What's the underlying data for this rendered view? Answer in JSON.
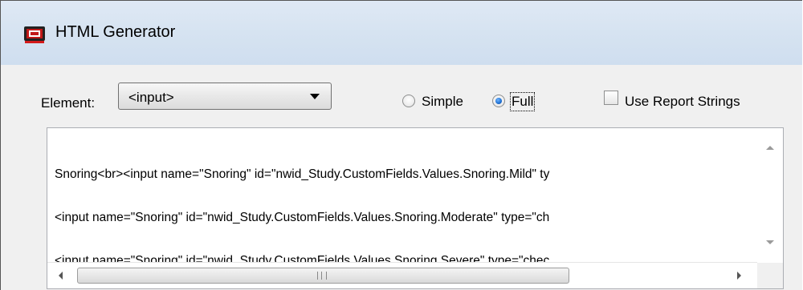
{
  "window": {
    "title": "HTML Generator",
    "icon": "html-generator-icon"
  },
  "element": {
    "label": "Element:",
    "selected": "<input>"
  },
  "mode": {
    "simple_label": "Simple",
    "full_label": "Full",
    "selected": "Full"
  },
  "use_report_strings": {
    "label": "Use Report Strings",
    "checked": false
  },
  "output": {
    "lines": [
      "Snoring<br><input name=\"Snoring\" id=\"nwid_Study.CustomFields.Values.Snoring.Mild\" ty",
      "<input name=\"Snoring\" id=\"nwid_Study.CustomFields.Values.Snoring.Moderate\" type=\"ch",
      "<input name=\"Snoring\" id=\"nwid_Study.CustomFields.Values.Snoring.Severe\" type=\"chec"
    ]
  },
  "scrollbar": {
    "grip": "III"
  }
}
